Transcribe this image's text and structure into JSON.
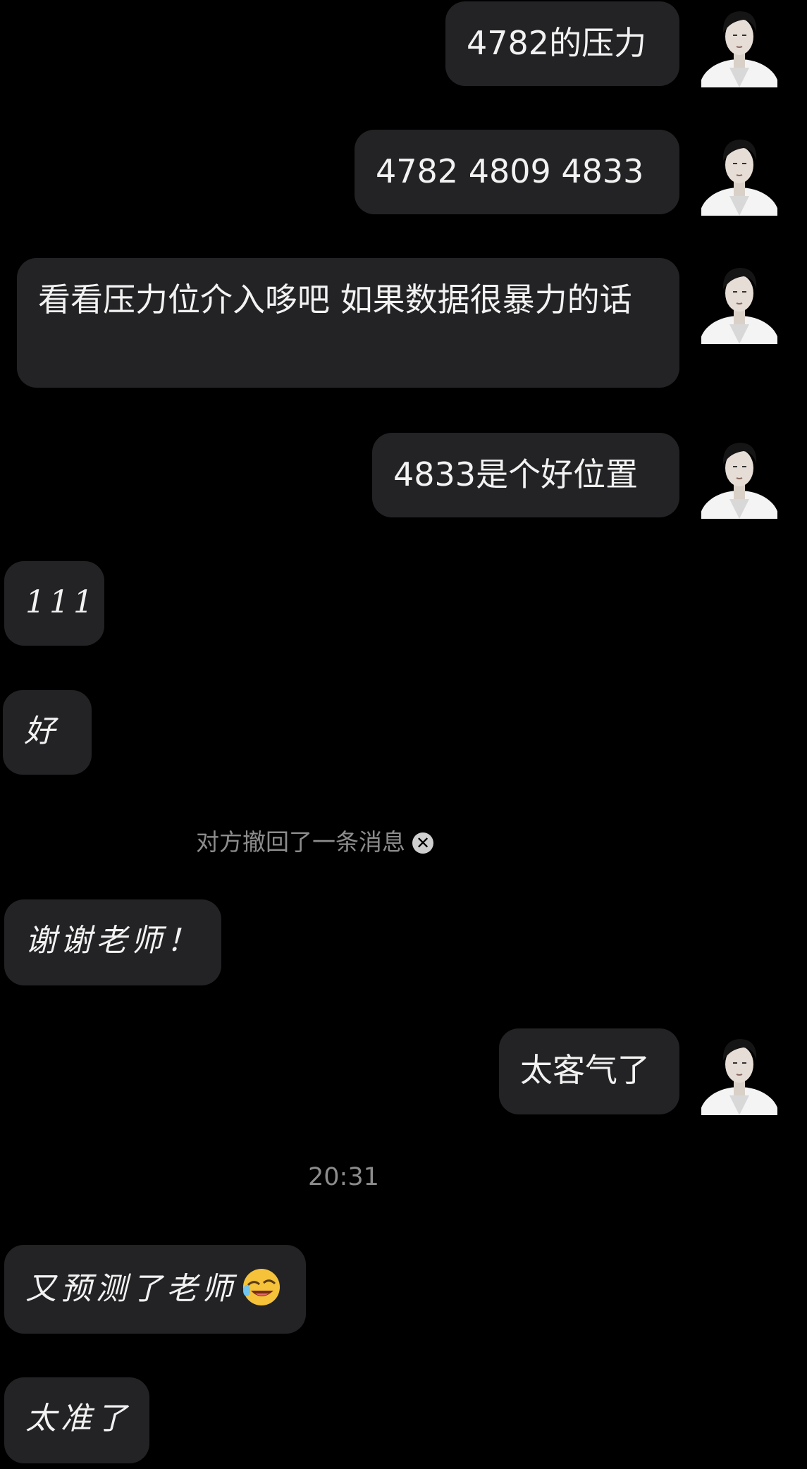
{
  "messages": [
    {
      "side": "out",
      "text": "4782的压力"
    },
    {
      "side": "out",
      "text": "4782 4809 4833"
    },
    {
      "side": "out",
      "text": "看看压力位介入哆吧  如果数据很暴力的话"
    },
    {
      "side": "out",
      "text": "4833是个好位置"
    },
    {
      "side": "in",
      "text": "111"
    },
    {
      "side": "in",
      "text": "好"
    },
    {
      "side": "system",
      "text": "对方撤回了一条消息"
    },
    {
      "side": "in",
      "text": "谢谢老师！"
    },
    {
      "side": "out",
      "text": "太客气了"
    },
    {
      "side": "time",
      "text": "20:31"
    },
    {
      "side": "in",
      "text": "又预测了老师",
      "emoji": "laughing-winking-face-emoji"
    },
    {
      "side": "in",
      "text": "太准了"
    }
  ],
  "colors": {
    "background": "#000000",
    "bubble": "#232325",
    "text": "#f2f2f2",
    "system_text": "#8c8c8c"
  }
}
